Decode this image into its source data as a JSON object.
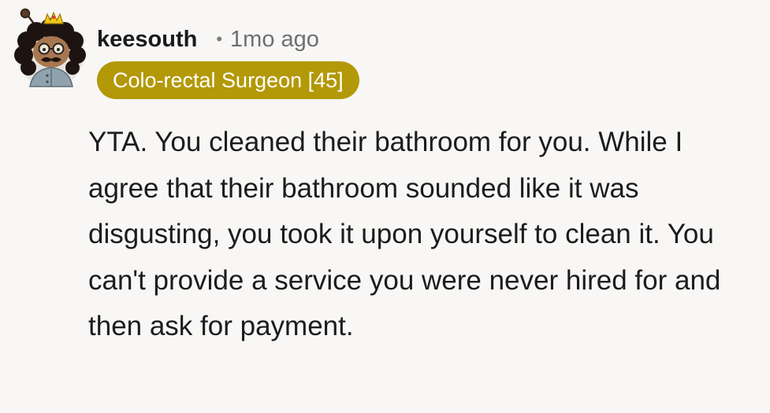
{
  "comment": {
    "author": "keesouth",
    "separator": "•",
    "timestamp": "1mo ago",
    "flair": "Colo-rectal Surgeon [45]",
    "body": "YTA. You cleaned their bathroom for you. While I agree that their bathroom sounded like it was disgusting, you took it upon yourself to clean it. You can't provide a service you were never hired for and then ask for payment."
  },
  "colors": {
    "background": "#f8f7f6",
    "flair_background": "#b39807",
    "flair_text": "#ffffff",
    "username": "#1a1a1b",
    "timestamp": "#6f6f6f"
  },
  "icons": {
    "avatar": "snoo-avatar-icon"
  }
}
